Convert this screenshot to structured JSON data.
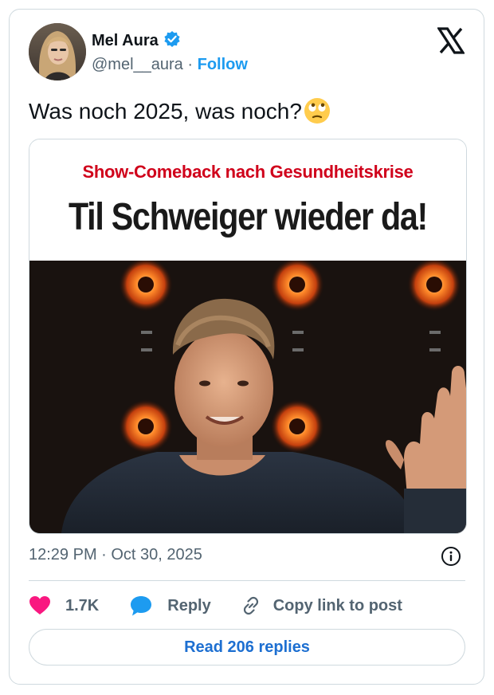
{
  "author": {
    "name": "Mel Aura",
    "handle": "@mel__aura",
    "separator": "·",
    "follow_label": "Follow"
  },
  "tweet": {
    "text": "Was noch 2025, was noch?",
    "emoji": "face-with-rolling-eyes"
  },
  "media": {
    "kicker": "Show-Comeback nach Gesundheitskrise",
    "headline": "Til Schweiger wieder da!"
  },
  "meta": {
    "timestamp": "12:29 PM · Oct 30, 2025"
  },
  "actions": {
    "likes": "1.7K",
    "reply_label": "Reply",
    "copy_label": "Copy link to post"
  },
  "footer": {
    "read_replies_label": "Read 206 replies"
  },
  "colors": {
    "accent": "#1d9bf0",
    "like": "#f91880",
    "kicker": "#d0021b",
    "text_secondary": "#536471"
  }
}
